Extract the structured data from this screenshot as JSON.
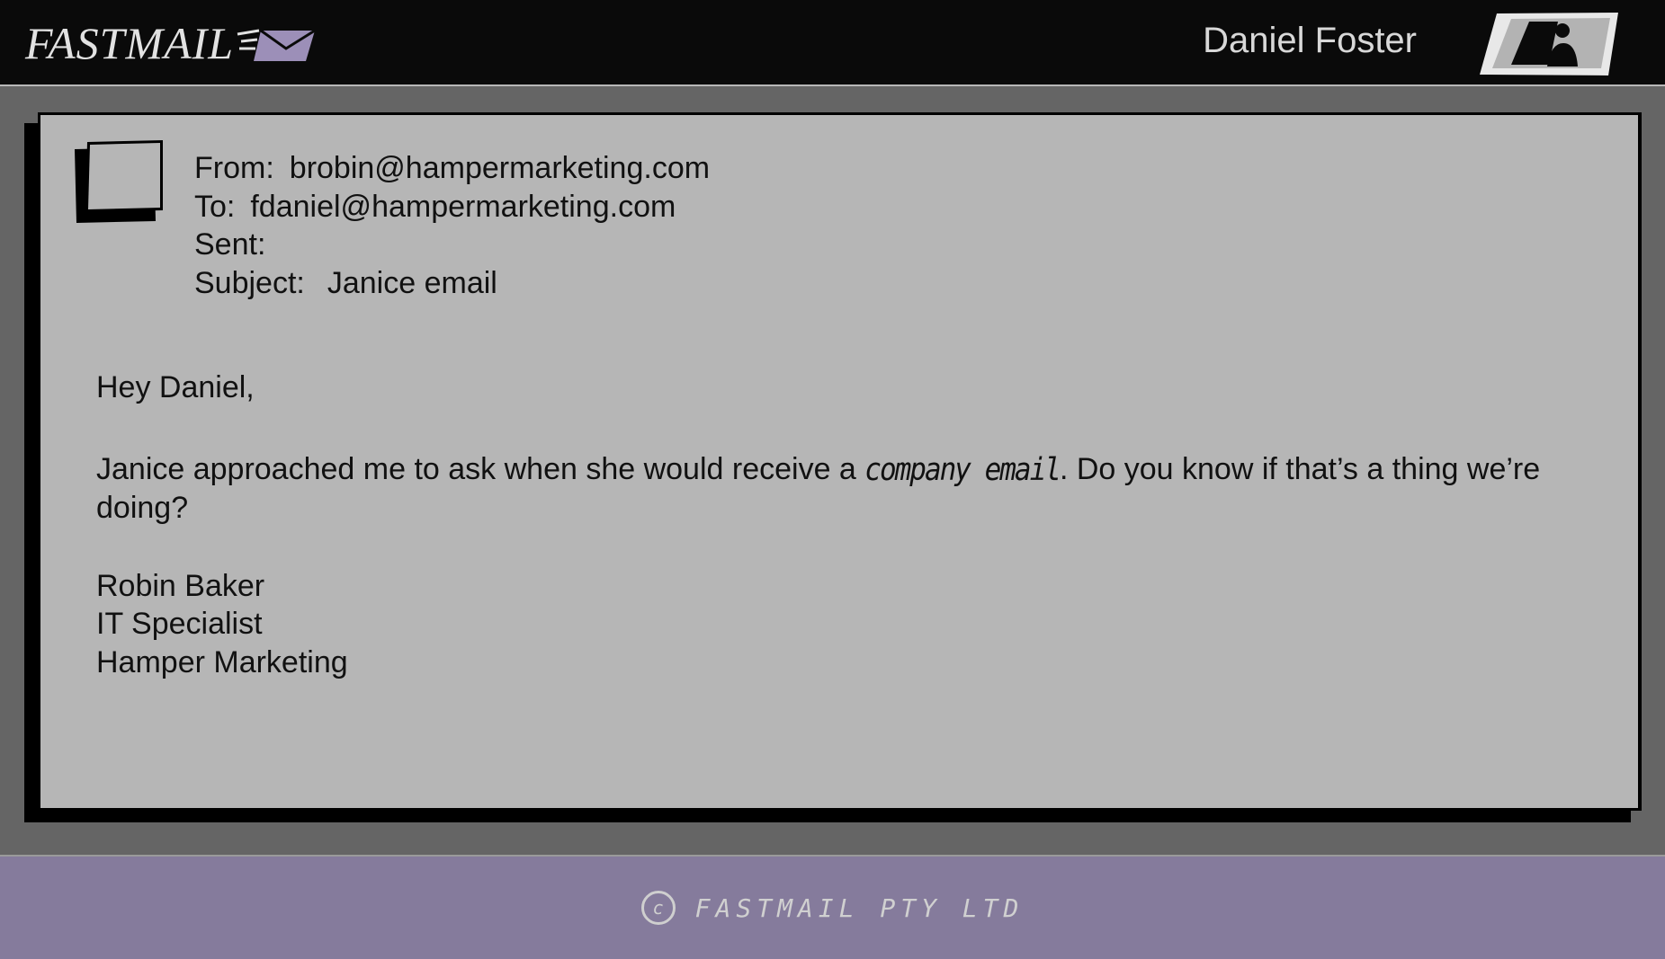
{
  "header": {
    "logo_text": "FASTMAIL",
    "logo_icon": "envelope-icon",
    "user_name": "Daniel Foster",
    "profile_icon": "profile-card-icon"
  },
  "email": {
    "avatar_icon": "avatar-placeholder-icon",
    "from_label": "From:",
    "from_value": "brobin@hampermarketing.com",
    "to_label": "To:",
    "to_value": "fdaniel@hampermarketing.com",
    "sent_label": "Sent:",
    "sent_value": "",
    "subject_label": "Subject:",
    "subject_value": "Janice email",
    "body": {
      "greeting": "Hey Daniel,",
      "para_before": "Janice approached me to ask when she would receive a ",
      "para_emphasis": "company email",
      "para_after": ". Do you know if that’s a thing we’re doing?",
      "signature": [
        "Robin Baker",
        "IT Specialist",
        "Hamper Marketing"
      ]
    }
  },
  "footer": {
    "copyright_symbol": "c",
    "copyright_text": "FASTMAIL PTY LTD"
  },
  "colors": {
    "header_bg": "#0a0a0a",
    "page_bg": "#656565",
    "card_bg": "#b6b6b6",
    "footer_bg": "#857b9c",
    "envelope_accent": "#9c8fb8"
  }
}
